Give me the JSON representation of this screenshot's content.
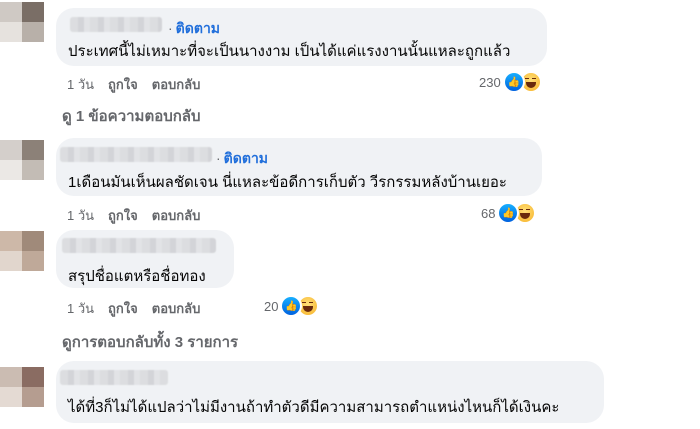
{
  "comments": [
    {
      "follow_label": "ติดตาม",
      "text": "ประเทศนี้ไม่เหมาะที่จะเป็นนางงาม เป็นได้แค่แรงงานนั้นแหละถูกแล้ว",
      "time": "1 วัน",
      "like_label": "ถูกใจ",
      "reply_label": "ตอบกลับ",
      "reaction_count": "230"
    },
    {
      "follow_label": "ติดตาม",
      "text": "1เดือนมันเห็นผลชัดเจน นี่แหละข้อดีการเก็บตัว วีรกรรมหลังบ้านเยอะ",
      "time": "1 วัน",
      "like_label": "ถูกใจ",
      "reply_label": "ตอบกลับ",
      "reaction_count": "68"
    },
    {
      "text": "สรุปชื่อแตหรือชื่อทอง",
      "time": "1 วัน",
      "like_label": "ถูกใจ",
      "reply_label": "ตอบกลับ",
      "reaction_count": "20"
    },
    {
      "text": "ได้ที่3ก็ไม่ได้แปลว่าไม่มีงานถ้าทำตัวดีมีความสามารถตำแหน่งไหนก็ได้เงินคะ"
    }
  ],
  "view_replies": [
    "ดู 1 ข้อความตอบกลับ",
    "ดูการตอบกลับทั้ง 3 รายการ"
  ],
  "colors": {
    "bubble": "#f0f2f5",
    "follow": "#216fdb",
    "meta": "#65676b",
    "like": "#0866ff"
  },
  "icons": [
    "like-reaction-icon",
    "haha-reaction-icon"
  ]
}
